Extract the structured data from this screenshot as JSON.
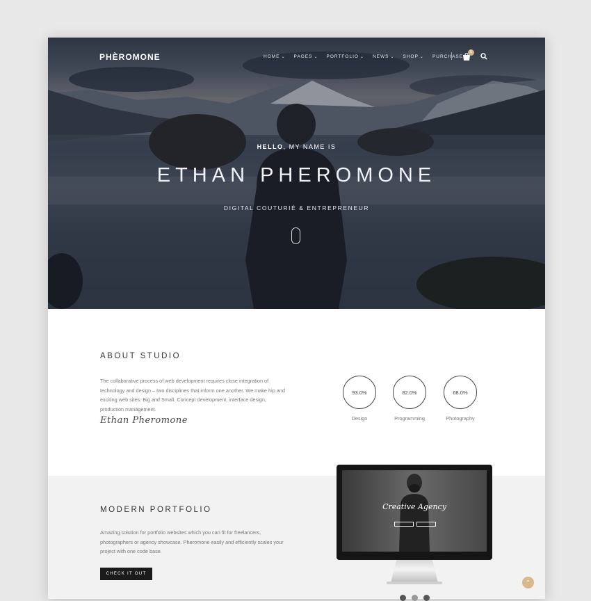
{
  "header": {
    "brand": "PHÈROMONE",
    "nav": [
      {
        "label": "HOME",
        "has_dropdown": true
      },
      {
        "label": "PAGES",
        "has_dropdown": true
      },
      {
        "label": "PORTFOLIO",
        "has_dropdown": true
      },
      {
        "label": "NEWS",
        "has_dropdown": true
      },
      {
        "label": "SHOP",
        "has_dropdown": true
      },
      {
        "label": "PURCHASE",
        "has_dropdown": false
      }
    ],
    "cart_count": "0",
    "icons": [
      "cart-icon",
      "search-icon"
    ]
  },
  "hero": {
    "hello_bold": "HELLO",
    "hello_rest": ", MY NAME IS",
    "name": "ETHAN PHEROMONE",
    "tagline": "DIGITAL COUTURIÉ & ENTREPRENEUR"
  },
  "about": {
    "title": "ABOUT STUDIO",
    "text": "The collaborative process of web development requires close integration of technology and design – two disciplines that inform one another. We make hip and exciting web sites. Big and Small. Concept development, interface design, production management.",
    "signature": "Ethan Pheromone",
    "skills": [
      {
        "value": "93.0%",
        "label": "Design"
      },
      {
        "value": "82.0%",
        "label": "Programming"
      },
      {
        "value": "68.0%",
        "label": "Photography"
      }
    ]
  },
  "portfolio": {
    "title": "MODERN PORTFOLIO",
    "text": "Amazing solution for portfolio websites which you can fit for freelancers, photographers or agency showcase. Pheromone easily and efficiently scales your project with one code base.",
    "button": "CHECK IT OUT",
    "screen_title": "Creative Agency"
  },
  "colors": {
    "accent": "#d9b88e",
    "dark": "#1b1b1b",
    "gray_bg": "#f2f2f2"
  }
}
